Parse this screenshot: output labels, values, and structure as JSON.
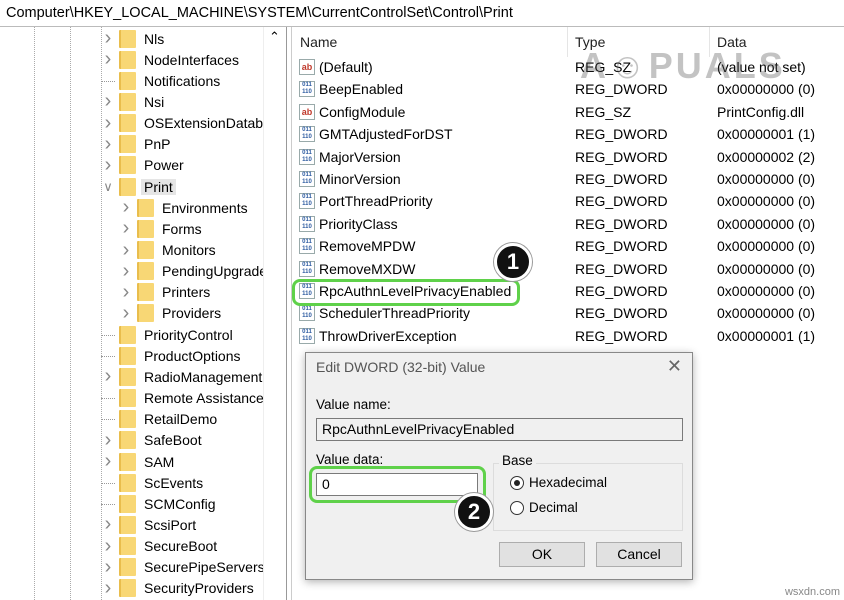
{
  "address": "Computer\\HKEY_LOCAL_MACHINE\\SYSTEM\\CurrentControlSet\\Control\\Print",
  "tree": [
    {
      "label": "Nls",
      "depth": 1,
      "expander": "collapsed"
    },
    {
      "label": "NodeInterfaces",
      "depth": 1,
      "expander": "collapsed"
    },
    {
      "label": "Notifications",
      "depth": 1,
      "expander": "none"
    },
    {
      "label": "Nsi",
      "depth": 1,
      "expander": "collapsed"
    },
    {
      "label": "OSExtensionDataba",
      "depth": 1,
      "expander": "collapsed"
    },
    {
      "label": "PnP",
      "depth": 1,
      "expander": "collapsed"
    },
    {
      "label": "Power",
      "depth": 1,
      "expander": "collapsed"
    },
    {
      "label": "Print",
      "depth": 1,
      "expander": "expanded",
      "selected": true
    },
    {
      "label": "Environments",
      "depth": 2,
      "expander": "collapsed"
    },
    {
      "label": "Forms",
      "depth": 2,
      "expander": "collapsed"
    },
    {
      "label": "Monitors",
      "depth": 2,
      "expander": "collapsed"
    },
    {
      "label": "PendingUpgrade",
      "depth": 2,
      "expander": "collapsed"
    },
    {
      "label": "Printers",
      "depth": 2,
      "expander": "collapsed"
    },
    {
      "label": "Providers",
      "depth": 2,
      "expander": "collapsed"
    },
    {
      "label": "PriorityControl",
      "depth": 1,
      "expander": "none"
    },
    {
      "label": "ProductOptions",
      "depth": 1,
      "expander": "none"
    },
    {
      "label": "RadioManagement",
      "depth": 1,
      "expander": "collapsed"
    },
    {
      "label": "Remote Assistance",
      "depth": 1,
      "expander": "none"
    },
    {
      "label": "RetailDemo",
      "depth": 1,
      "expander": "none"
    },
    {
      "label": "SafeBoot",
      "depth": 1,
      "expander": "collapsed"
    },
    {
      "label": "SAM",
      "depth": 1,
      "expander": "collapsed"
    },
    {
      "label": "ScEvents",
      "depth": 1,
      "expander": "none"
    },
    {
      "label": "SCMConfig",
      "depth": 1,
      "expander": "none"
    },
    {
      "label": "ScsiPort",
      "depth": 1,
      "expander": "collapsed"
    },
    {
      "label": "SecureBoot",
      "depth": 1,
      "expander": "collapsed"
    },
    {
      "label": "SecurePipeServers",
      "depth": 1,
      "expander": "collapsed"
    },
    {
      "label": "SecurityProviders",
      "depth": 1,
      "expander": "collapsed"
    }
  ],
  "columns": {
    "name": "Name",
    "type": "Type",
    "data": "Data"
  },
  "values": [
    {
      "icon": "string-value-icon",
      "name": "(Default)",
      "type": "REG_SZ",
      "data": "(value not set)"
    },
    {
      "icon": "dword-value-icon",
      "name": "BeepEnabled",
      "type": "REG_DWORD",
      "data": "0x00000000 (0)"
    },
    {
      "icon": "string-value-icon",
      "name": "ConfigModule",
      "type": "REG_SZ",
      "data": "PrintConfig.dll"
    },
    {
      "icon": "dword-value-icon",
      "name": "GMTAdjustedForDST",
      "type": "REG_DWORD",
      "data": "0x00000001 (1)"
    },
    {
      "icon": "dword-value-icon",
      "name": "MajorVersion",
      "type": "REG_DWORD",
      "data": "0x00000002 (2)"
    },
    {
      "icon": "dword-value-icon",
      "name": "MinorVersion",
      "type": "REG_DWORD",
      "data": "0x00000000 (0)"
    },
    {
      "icon": "dword-value-icon",
      "name": "PortThreadPriority",
      "type": "REG_DWORD",
      "data": "0x00000000 (0)"
    },
    {
      "icon": "dword-value-icon",
      "name": "PriorityClass",
      "type": "REG_DWORD",
      "data": "0x00000000 (0)"
    },
    {
      "icon": "dword-value-icon",
      "name": "RemoveMPDW",
      "type": "REG_DWORD",
      "data": "0x00000000 (0)"
    },
    {
      "icon": "dword-value-icon",
      "name": "RemoveMXDW",
      "type": "REG_DWORD",
      "data": "0x00000000 (0)"
    },
    {
      "icon": "dword-value-icon",
      "name": "RpcAuthnLevelPrivacyEnabled",
      "type": "REG_DWORD",
      "data": "0x00000000 (0)"
    },
    {
      "icon": "dword-value-icon",
      "name": "SchedulerThreadPriority",
      "type": "REG_DWORD",
      "data": "0x00000000 (0)"
    },
    {
      "icon": "dword-value-icon",
      "name": "ThrowDriverException",
      "type": "REG_DWORD",
      "data": "0x00000001 (1)"
    }
  ],
  "icon_text": {
    "string": "ab",
    "dword": "011 110"
  },
  "watermark_logo": "APPUALS",
  "site_watermark": "wsxdn.com",
  "annotations": {
    "badge1": "1",
    "badge2": "2",
    "highlight_color": "#5fd14a"
  },
  "dialog": {
    "title": "Edit DWORD (32-bit) Value",
    "value_name_label": "Value name:",
    "value_name": "RpcAuthnLevelPrivacyEnabled",
    "value_data_label": "Value data:",
    "value_data": "0",
    "base_label": "Base",
    "hex_label": "Hexadecimal",
    "dec_label": "Decimal",
    "base_selected": "Hexadecimal",
    "ok": "OK",
    "cancel": "Cancel"
  }
}
